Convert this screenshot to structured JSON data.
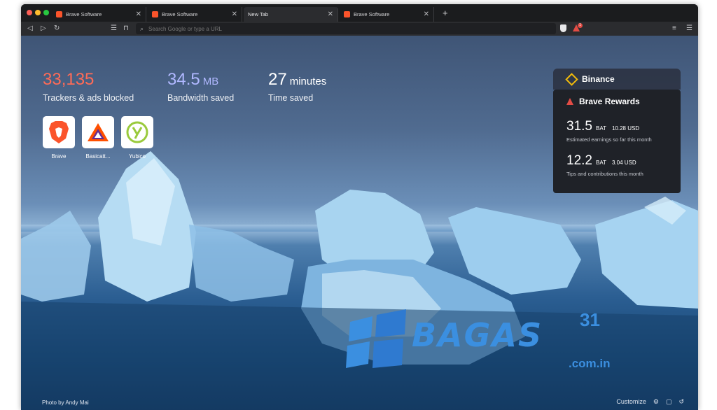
{
  "tabs": [
    {
      "title": "Brave Software",
      "active": false
    },
    {
      "title": "Brave Software",
      "active": false
    },
    {
      "title": "New Tab",
      "active": true
    },
    {
      "title": "Brave Software",
      "active": false
    }
  ],
  "toolbar": {
    "url_placeholder": "Search Google or type a URL",
    "rewards_badge": "1"
  },
  "stats": [
    {
      "value": "33,135",
      "unit": "",
      "label": "Trackers & ads blocked",
      "color": "#ff6b57"
    },
    {
      "value": "34.5",
      "unit": "MB",
      "label": "Bandwidth saved",
      "color": "#b0b8ff"
    },
    {
      "value": "27",
      "unit": "minutes",
      "label": "Time saved",
      "color": "#ffffff"
    }
  ],
  "top_sites": [
    {
      "name": "Brave",
      "icon": "brave-lion-icon"
    },
    {
      "name": "Basicatt...",
      "icon": "basic-attention-token-icon"
    },
    {
      "name": "Yubico",
      "icon": "yubico-icon"
    }
  ],
  "binance": {
    "title": "Binance"
  },
  "rewards": {
    "title": "Brave Rewards",
    "earnings": {
      "value": "31.5",
      "unit": "BAT",
      "usd": "10.28 USD",
      "desc": "Estimated earnings so far this month"
    },
    "tips": {
      "value": "12.2",
      "unit": "BAT",
      "usd": "3.04 USD",
      "desc": "Tips and contributions this month"
    }
  },
  "watermark": {
    "text": "BAGAS",
    "number": "31",
    "domain": ".com.in"
  },
  "footer": {
    "photo_credit": "Photo by Andy Mai",
    "customize": "Customize"
  }
}
